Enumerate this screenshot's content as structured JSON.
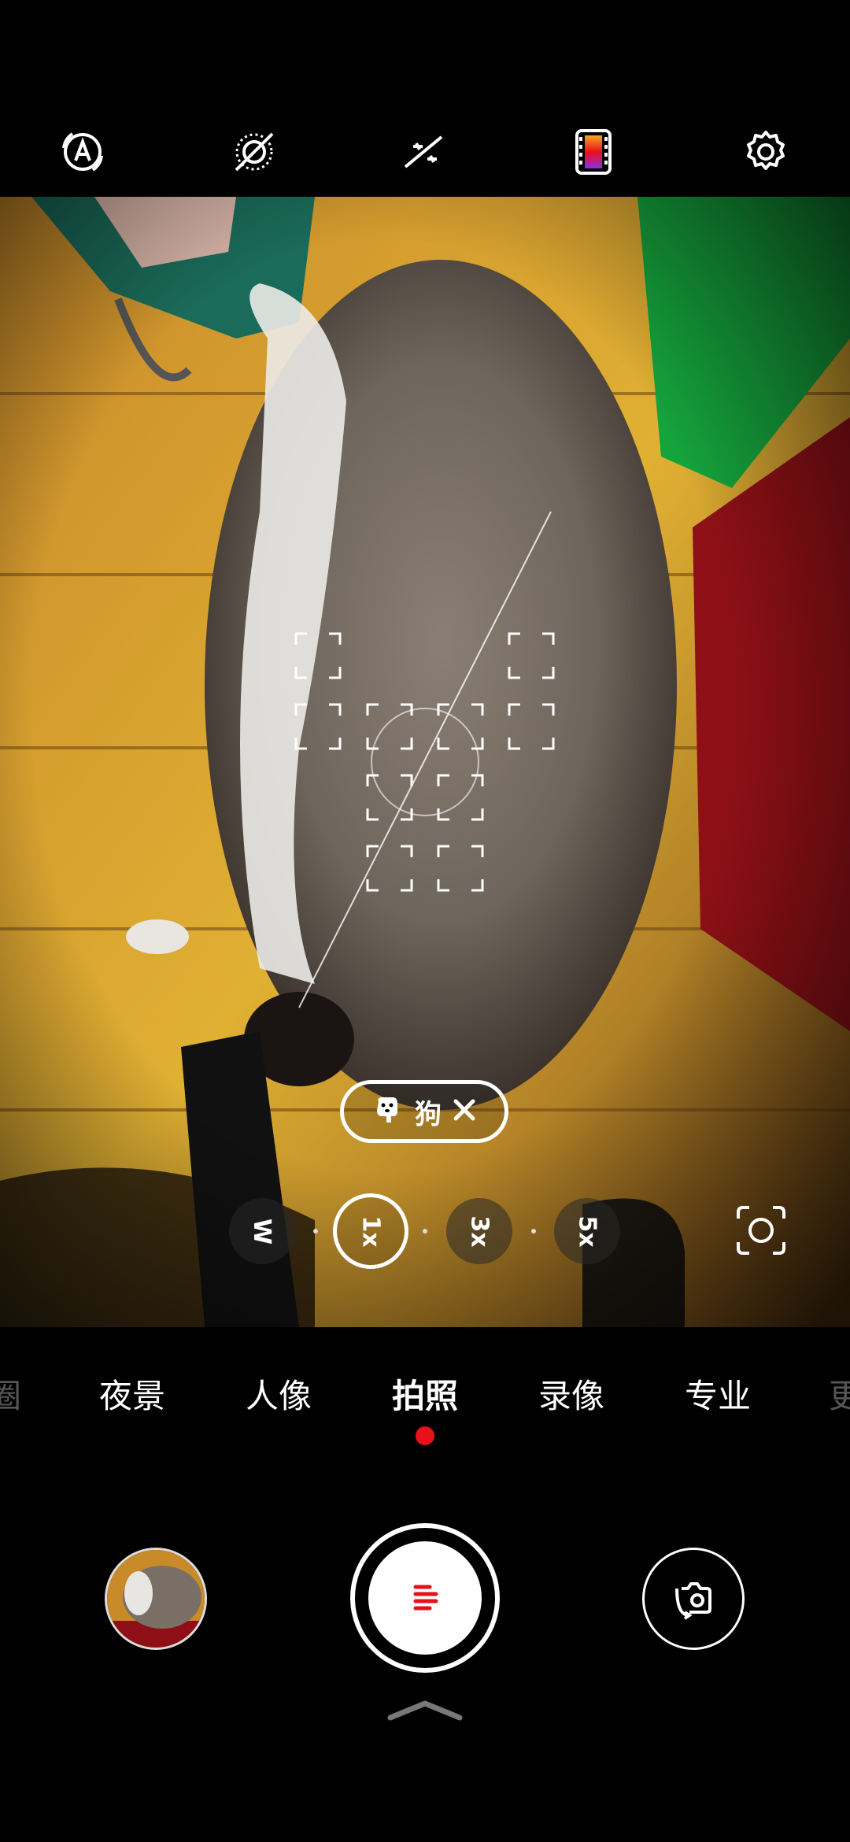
{
  "top_toolbar": {
    "icons": [
      "ai-mode-icon",
      "flash-off-icon",
      "wand-enhance-icon",
      "film-filter-icon",
      "settings-gear-icon"
    ]
  },
  "viewfinder": {
    "subject_tag": {
      "icon": "dog-icon",
      "label": "狗",
      "close_icon": "close-icon"
    },
    "zoom_levels": [
      "W",
      "1x",
      "3x",
      "5x"
    ],
    "active_zoom": "1x",
    "lens_switch_icon": "lens-switch-icon"
  },
  "modes": {
    "items": [
      "夜景",
      "人像",
      "拍照",
      "录像",
      "专业"
    ],
    "active": "拍照",
    "accent_color": "#e8101a"
  },
  "bottom_controls": {
    "gallery_thumbnail": "gallery-thumbnail",
    "shutter_icon": "shutter-menu-icon",
    "shutter_accent": "#e8101a",
    "switch_camera_icon": "switch-camera-icon",
    "more_handle_icon": "chevron-up-icon"
  }
}
